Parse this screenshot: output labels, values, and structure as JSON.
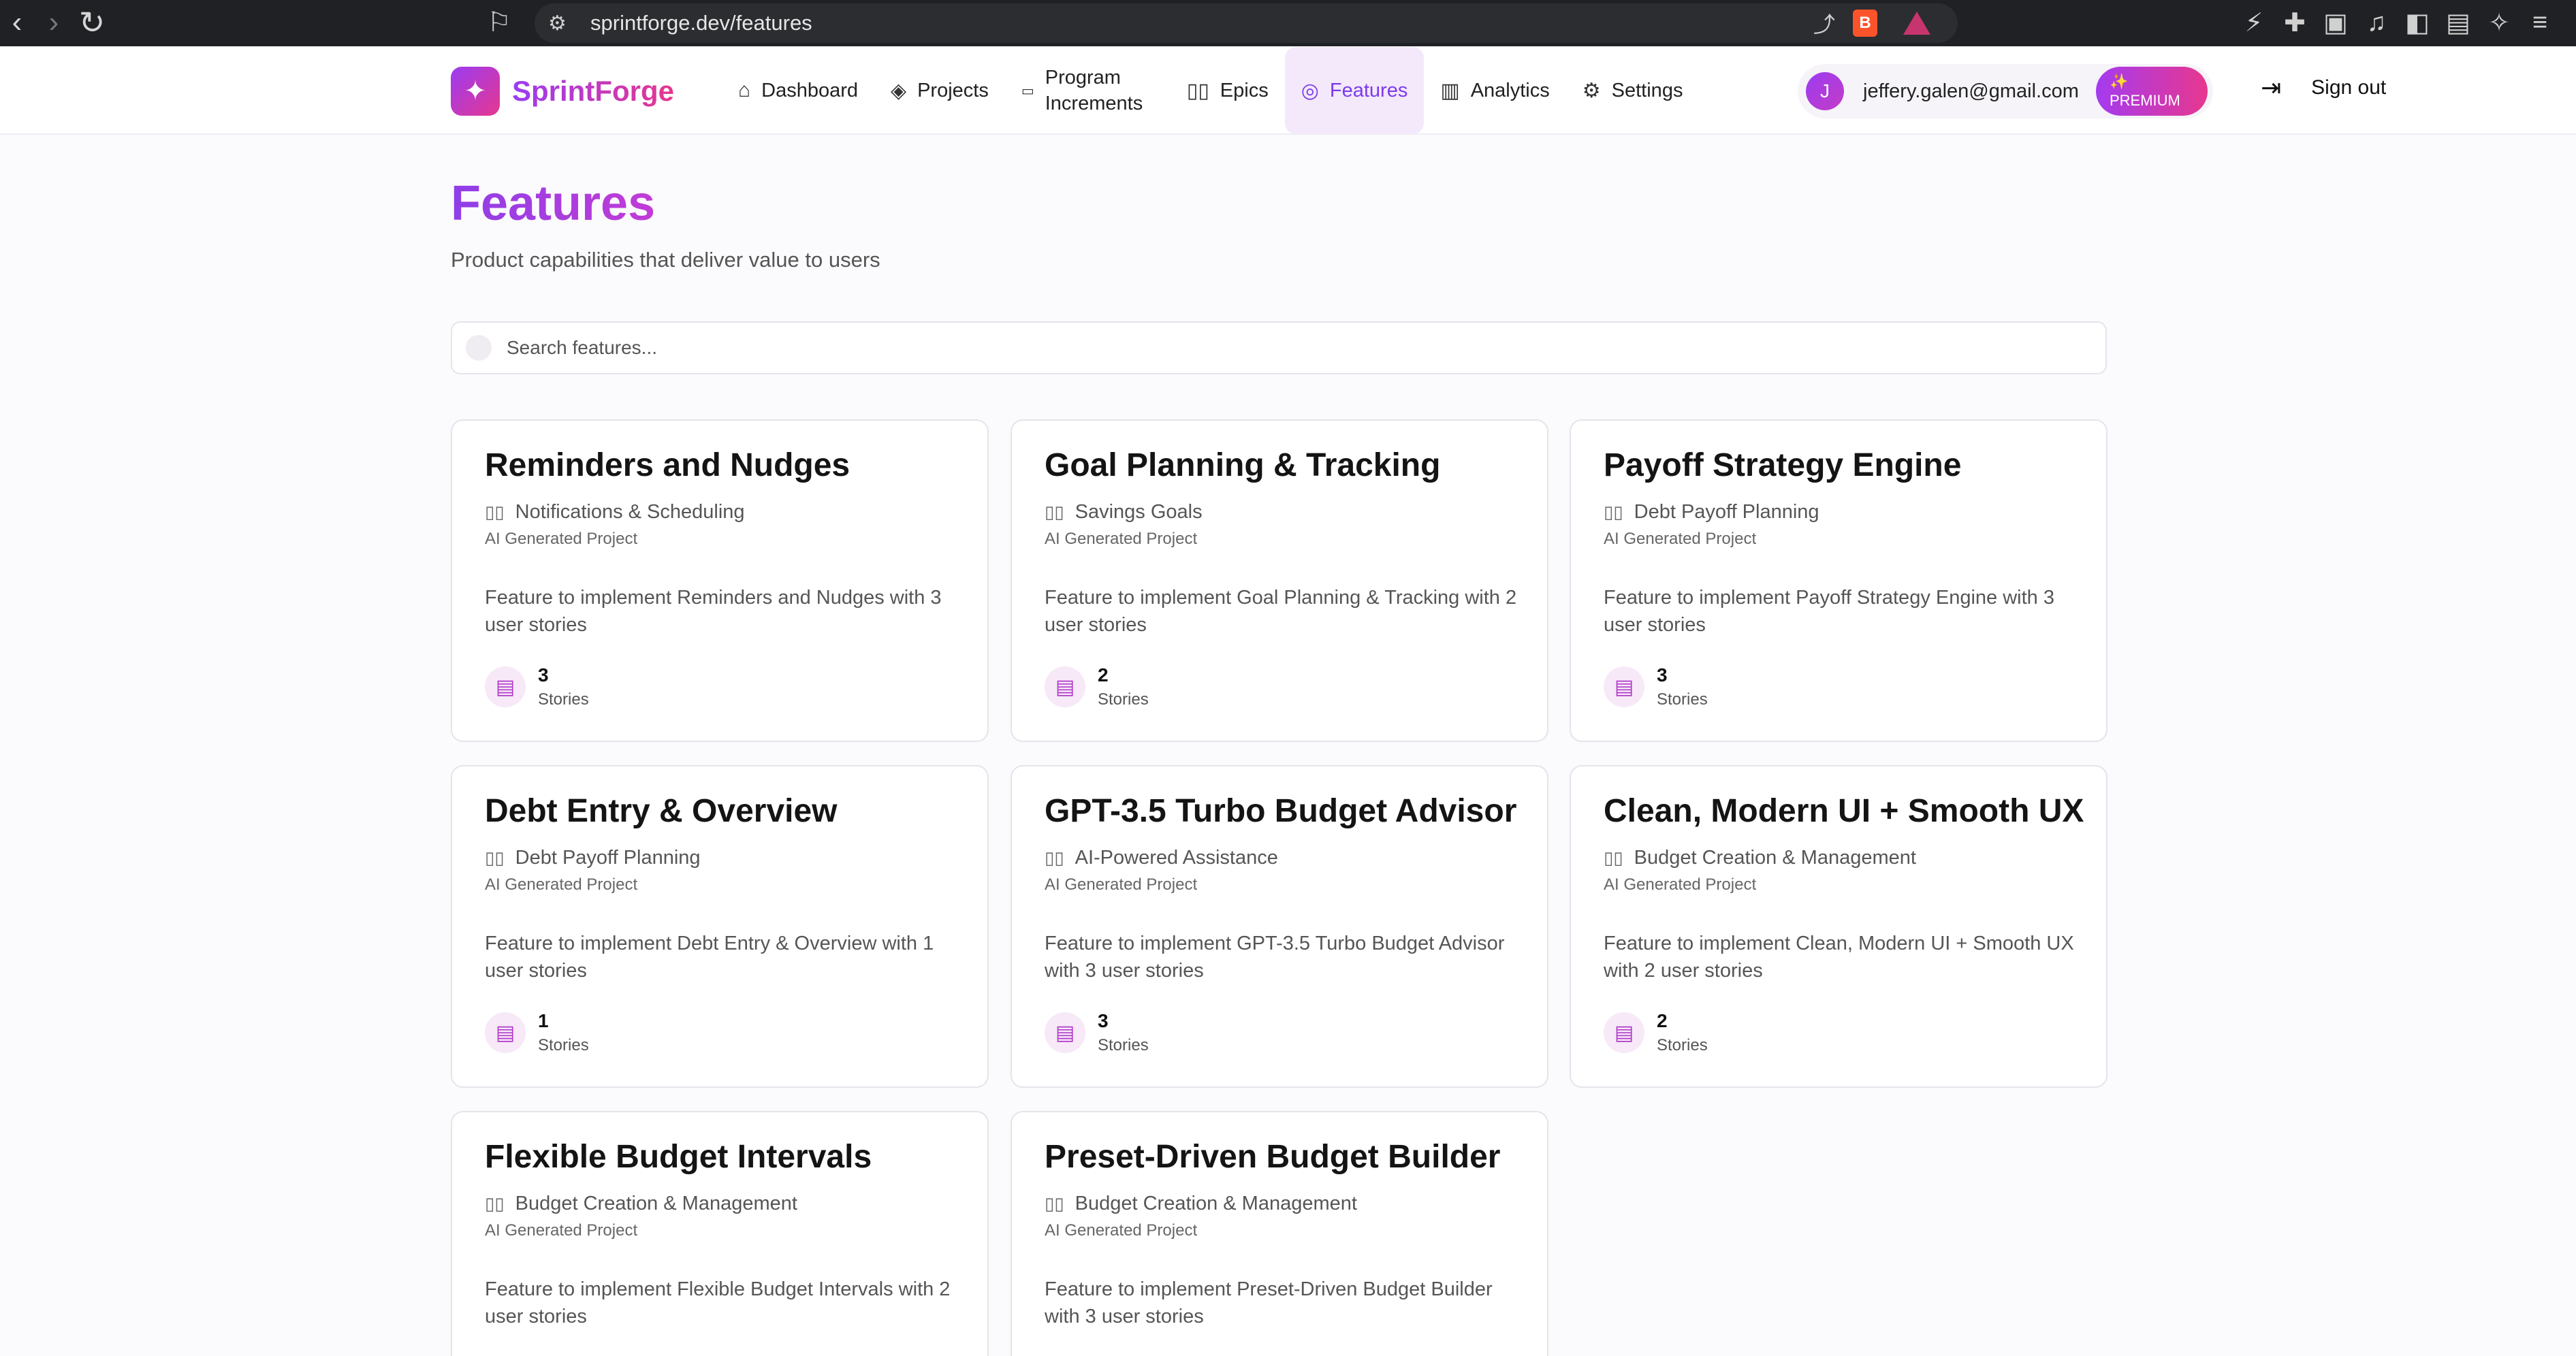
{
  "browser": {
    "url": "sprintforge.dev/features"
  },
  "app": {
    "name": "SprintForge",
    "nav": [
      {
        "label": "Dashboard",
        "icon": "home-icon"
      },
      {
        "label": "Projects",
        "icon": "layers-icon"
      },
      {
        "label": "Program Increments",
        "icon": "calendar-icon"
      },
      {
        "label": "Epics",
        "icon": "book-icon"
      },
      {
        "label": "Features",
        "icon": "target-icon",
        "active": true
      },
      {
        "label": "Analytics",
        "icon": "bar-chart-icon"
      },
      {
        "label": "Settings",
        "icon": "gear-icon"
      }
    ],
    "user": {
      "initial": "J",
      "email": "jeffery.galen@gmail.com",
      "badge_sparkle": "✨",
      "badge": "PREMIUM"
    },
    "signout": "Sign out"
  },
  "page": {
    "title": "Features",
    "subtitle": "Product capabilities that deliver value to users",
    "search_placeholder": "Search features..."
  },
  "features": [
    {
      "title": "Reminders and Nudges",
      "epic": "Notifications & Scheduling",
      "project": "AI Generated Project",
      "description": "Feature to implement Reminders and Nudges with 3 user stories",
      "stories": "3",
      "stories_label": "Stories"
    },
    {
      "title": "Goal Planning & Tracking",
      "epic": "Savings Goals",
      "project": "AI Generated Project",
      "description": "Feature to implement Goal Planning & Tracking with 2 user stories",
      "stories": "2",
      "stories_label": "Stories"
    },
    {
      "title": "Payoff Strategy Engine",
      "epic": "Debt Payoff Planning",
      "project": "AI Generated Project",
      "description": "Feature to implement Payoff Strategy Engine with 3 user stories",
      "stories": "3",
      "stories_label": "Stories"
    },
    {
      "title": "Debt Entry & Overview",
      "epic": "Debt Payoff Planning",
      "project": "AI Generated Project",
      "description": "Feature to implement Debt Entry & Overview with 1 user stories",
      "stories": "1",
      "stories_label": "Stories"
    },
    {
      "title": "GPT-3.5 Turbo Budget Advisor",
      "epic": "AI-Powered Assistance",
      "project": "AI Generated Project",
      "description": "Feature to implement GPT-3.5 Turbo Budget Advisor with 3 user stories",
      "stories": "3",
      "stories_label": "Stories"
    },
    {
      "title": "Clean, Modern UI + Smooth UX",
      "epic": "Budget Creation & Management",
      "project": "AI Generated Project",
      "description": "Feature to implement Clean, Modern UI + Smooth UX with 2 user stories",
      "stories": "2",
      "stories_label": "Stories"
    },
    {
      "title": "Flexible Budget Intervals",
      "epic": "Budget Creation & Management",
      "project": "AI Generated Project",
      "description": "Feature to implement Flexible Budget Intervals with 2 user stories"
    },
    {
      "title": "Preset-Driven Budget Builder",
      "epic": "Budget Creation & Management",
      "project": "AI Generated Project",
      "description": "Feature to implement Preset-Driven Budget Builder with 3 user stories"
    }
  ]
}
